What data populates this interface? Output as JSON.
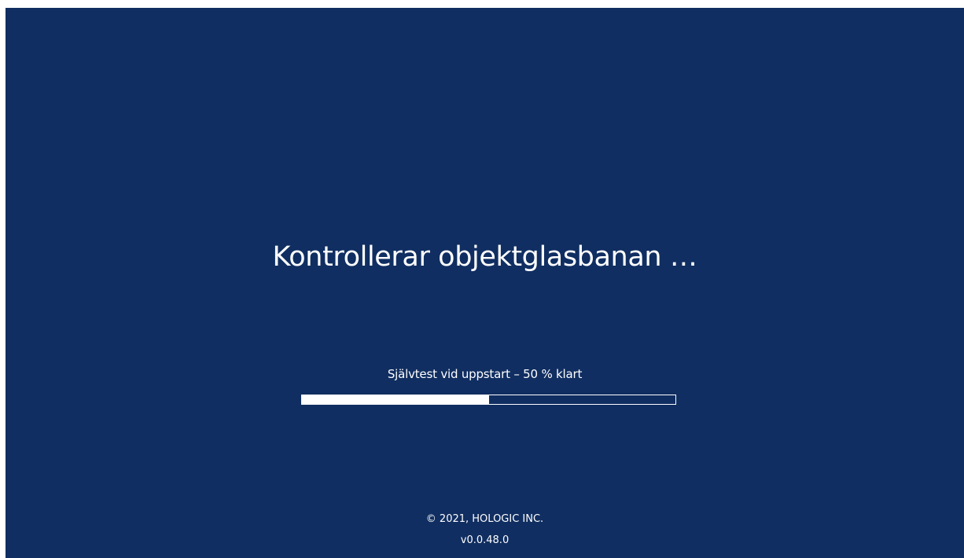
{
  "theme": {
    "background_color": "#102E61",
    "text_color": "#FFFFFF"
  },
  "status": {
    "heading": "Kontrollerar objektglasbanan …"
  },
  "progress": {
    "label": "Självtest vid uppstart – 50 % klart",
    "fraction": 0.5
  },
  "footer": {
    "copyright": "© 2021, HOLOGIC INC.",
    "version": "v0.0.48.0"
  }
}
